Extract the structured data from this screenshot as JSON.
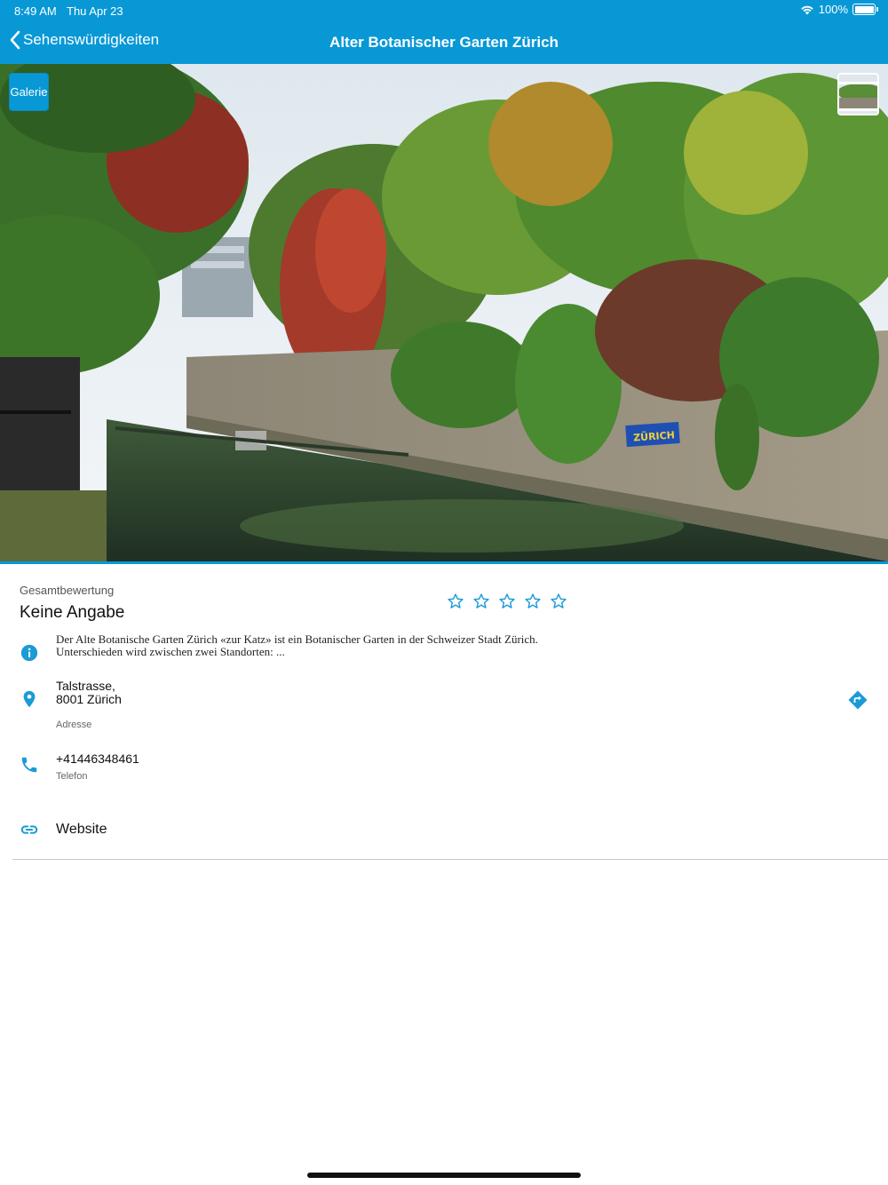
{
  "status_bar": {
    "time": "8:49 AM",
    "date": "Thu Apr 23",
    "battery": "100%",
    "battery_level": 1.0
  },
  "nav": {
    "back_label": "Sehenswürdigkeiten",
    "title": "Alter Botanischer Garten Zürich"
  },
  "hero": {
    "gallery_label": "Galerie",
    "sign_text": "ZÜRICH"
  },
  "rating": {
    "label": "Gesamtbewertung",
    "value": "Keine Angabe",
    "stars_total": 5,
    "stars_filled": 0
  },
  "description": {
    "line1": "Der Alte Botanische Garten Zürich «zur Katz» ist ein Botanischer Garten in der Schweizer Stadt Zürich.",
    "line2": "Unterschieden wird zwischen zwei Standorten: ..."
  },
  "address": {
    "street": "Talstrasse,",
    "city": "8001 Zürich",
    "label": "Adresse"
  },
  "phone": {
    "number": "+41446348461",
    "label": "Telefon"
  },
  "website": {
    "label": "Website"
  },
  "colors": {
    "accent": "#0898d6",
    "icon": "#1a9bd7",
    "separator": "#c8c8c8"
  },
  "icons": [
    "chevron-left-icon",
    "wifi-icon",
    "battery-icon",
    "info-icon",
    "location-pin-icon",
    "directions-icon",
    "phone-icon",
    "link-icon",
    "star-outline-icon"
  ]
}
